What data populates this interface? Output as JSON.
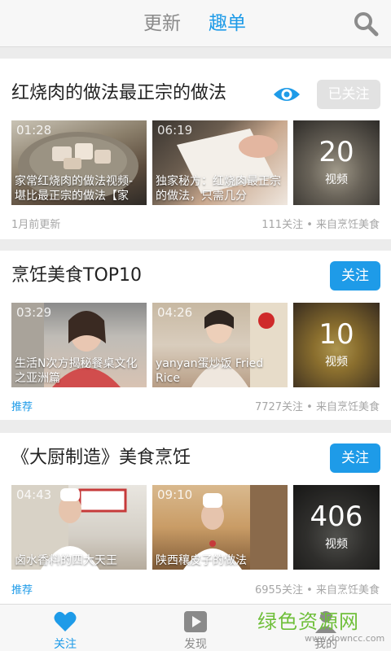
{
  "header": {
    "tabs": [
      {
        "label": "更新",
        "active": false
      },
      {
        "label": "趣单",
        "active": true
      }
    ],
    "search_icon": "search-icon",
    "accent_color": "#1e9be8"
  },
  "cards": [
    {
      "title": "红烧肉的做法最正宗的做法",
      "follow_label": "已关注",
      "followed": true,
      "videos": [
        {
          "duration": "01:28",
          "caption": "家常红烧肉的做法视频-堪比最正宗的做法【家"
        },
        {
          "duration": "06:19",
          "caption": "独家秘方：红烧肉最正宗的做法，只需几分"
        }
      ],
      "more_count": "20",
      "more_label": "视频",
      "footer_left": "1月前更新",
      "footer_right": "111关注 • 来自烹饪美食"
    },
    {
      "title": "烹饪美食TOP10",
      "follow_label": "关注",
      "followed": false,
      "videos": [
        {
          "duration": "03:29",
          "caption": "生活N次方揭秘餐桌文化之亚洲篇"
        },
        {
          "duration": "04:26",
          "caption": "yanyan蛋炒饭 Fried Rice"
        }
      ],
      "more_count": "10",
      "more_label": "视频",
      "footer_left": "推荐",
      "footer_right": "7727关注 • 来自烹饪美食"
    },
    {
      "title": "《大厨制造》美食烹饪",
      "follow_label": "关注",
      "followed": false,
      "videos": [
        {
          "duration": "04:43",
          "caption": "卤水香料的四大天王"
        },
        {
          "duration": "09:10",
          "caption": "陕西穰皮子的做法"
        }
      ],
      "more_count": "406",
      "more_label": "视频",
      "footer_left": "推荐",
      "footer_right": "6955关注 • 来自烹饪美食"
    }
  ],
  "bottom_nav": [
    {
      "label": "关注",
      "icon": "heart-icon",
      "active": true
    },
    {
      "label": "发现",
      "icon": "play-icon",
      "active": false
    },
    {
      "label": "我的",
      "icon": "user-icon",
      "active": false
    }
  ],
  "watermark": {
    "text": "绿色资源网",
    "url": "www.downcc.com"
  }
}
